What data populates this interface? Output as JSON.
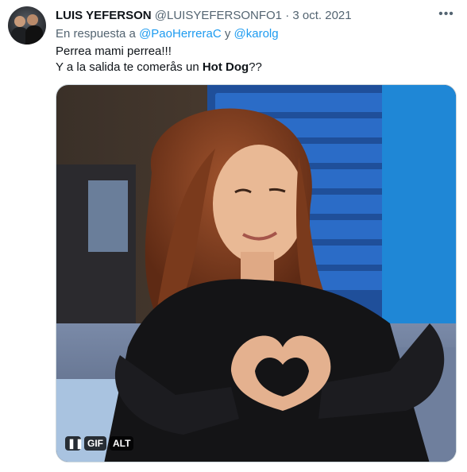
{
  "author": {
    "display_name": "LUIS YEFERSON",
    "handle": "@LUISYEFERSONFO1",
    "separator": "·",
    "date": "3 oct. 2021"
  },
  "reply_to": {
    "prefix": "En respuesta a",
    "user1": "@PaoHerreraC",
    "conjunction": "y",
    "user2": "@karolg"
  },
  "tweet": {
    "line1": "Perrea mami perrea!!!",
    "line2_prefix": "Y a la salida te comerås un",
    "line2_bold": "Hot Dog",
    "line2_suffix": "??"
  },
  "more_icon": "more-horizontal-icon",
  "media": {
    "type": "gif",
    "controls": {
      "pause": "❚❚",
      "gif": "GIF",
      "alt": "ALT"
    }
  },
  "colors": {
    "link": "#1d9bf0",
    "secondary_text": "#536471",
    "primary_text": "#0f1419"
  }
}
